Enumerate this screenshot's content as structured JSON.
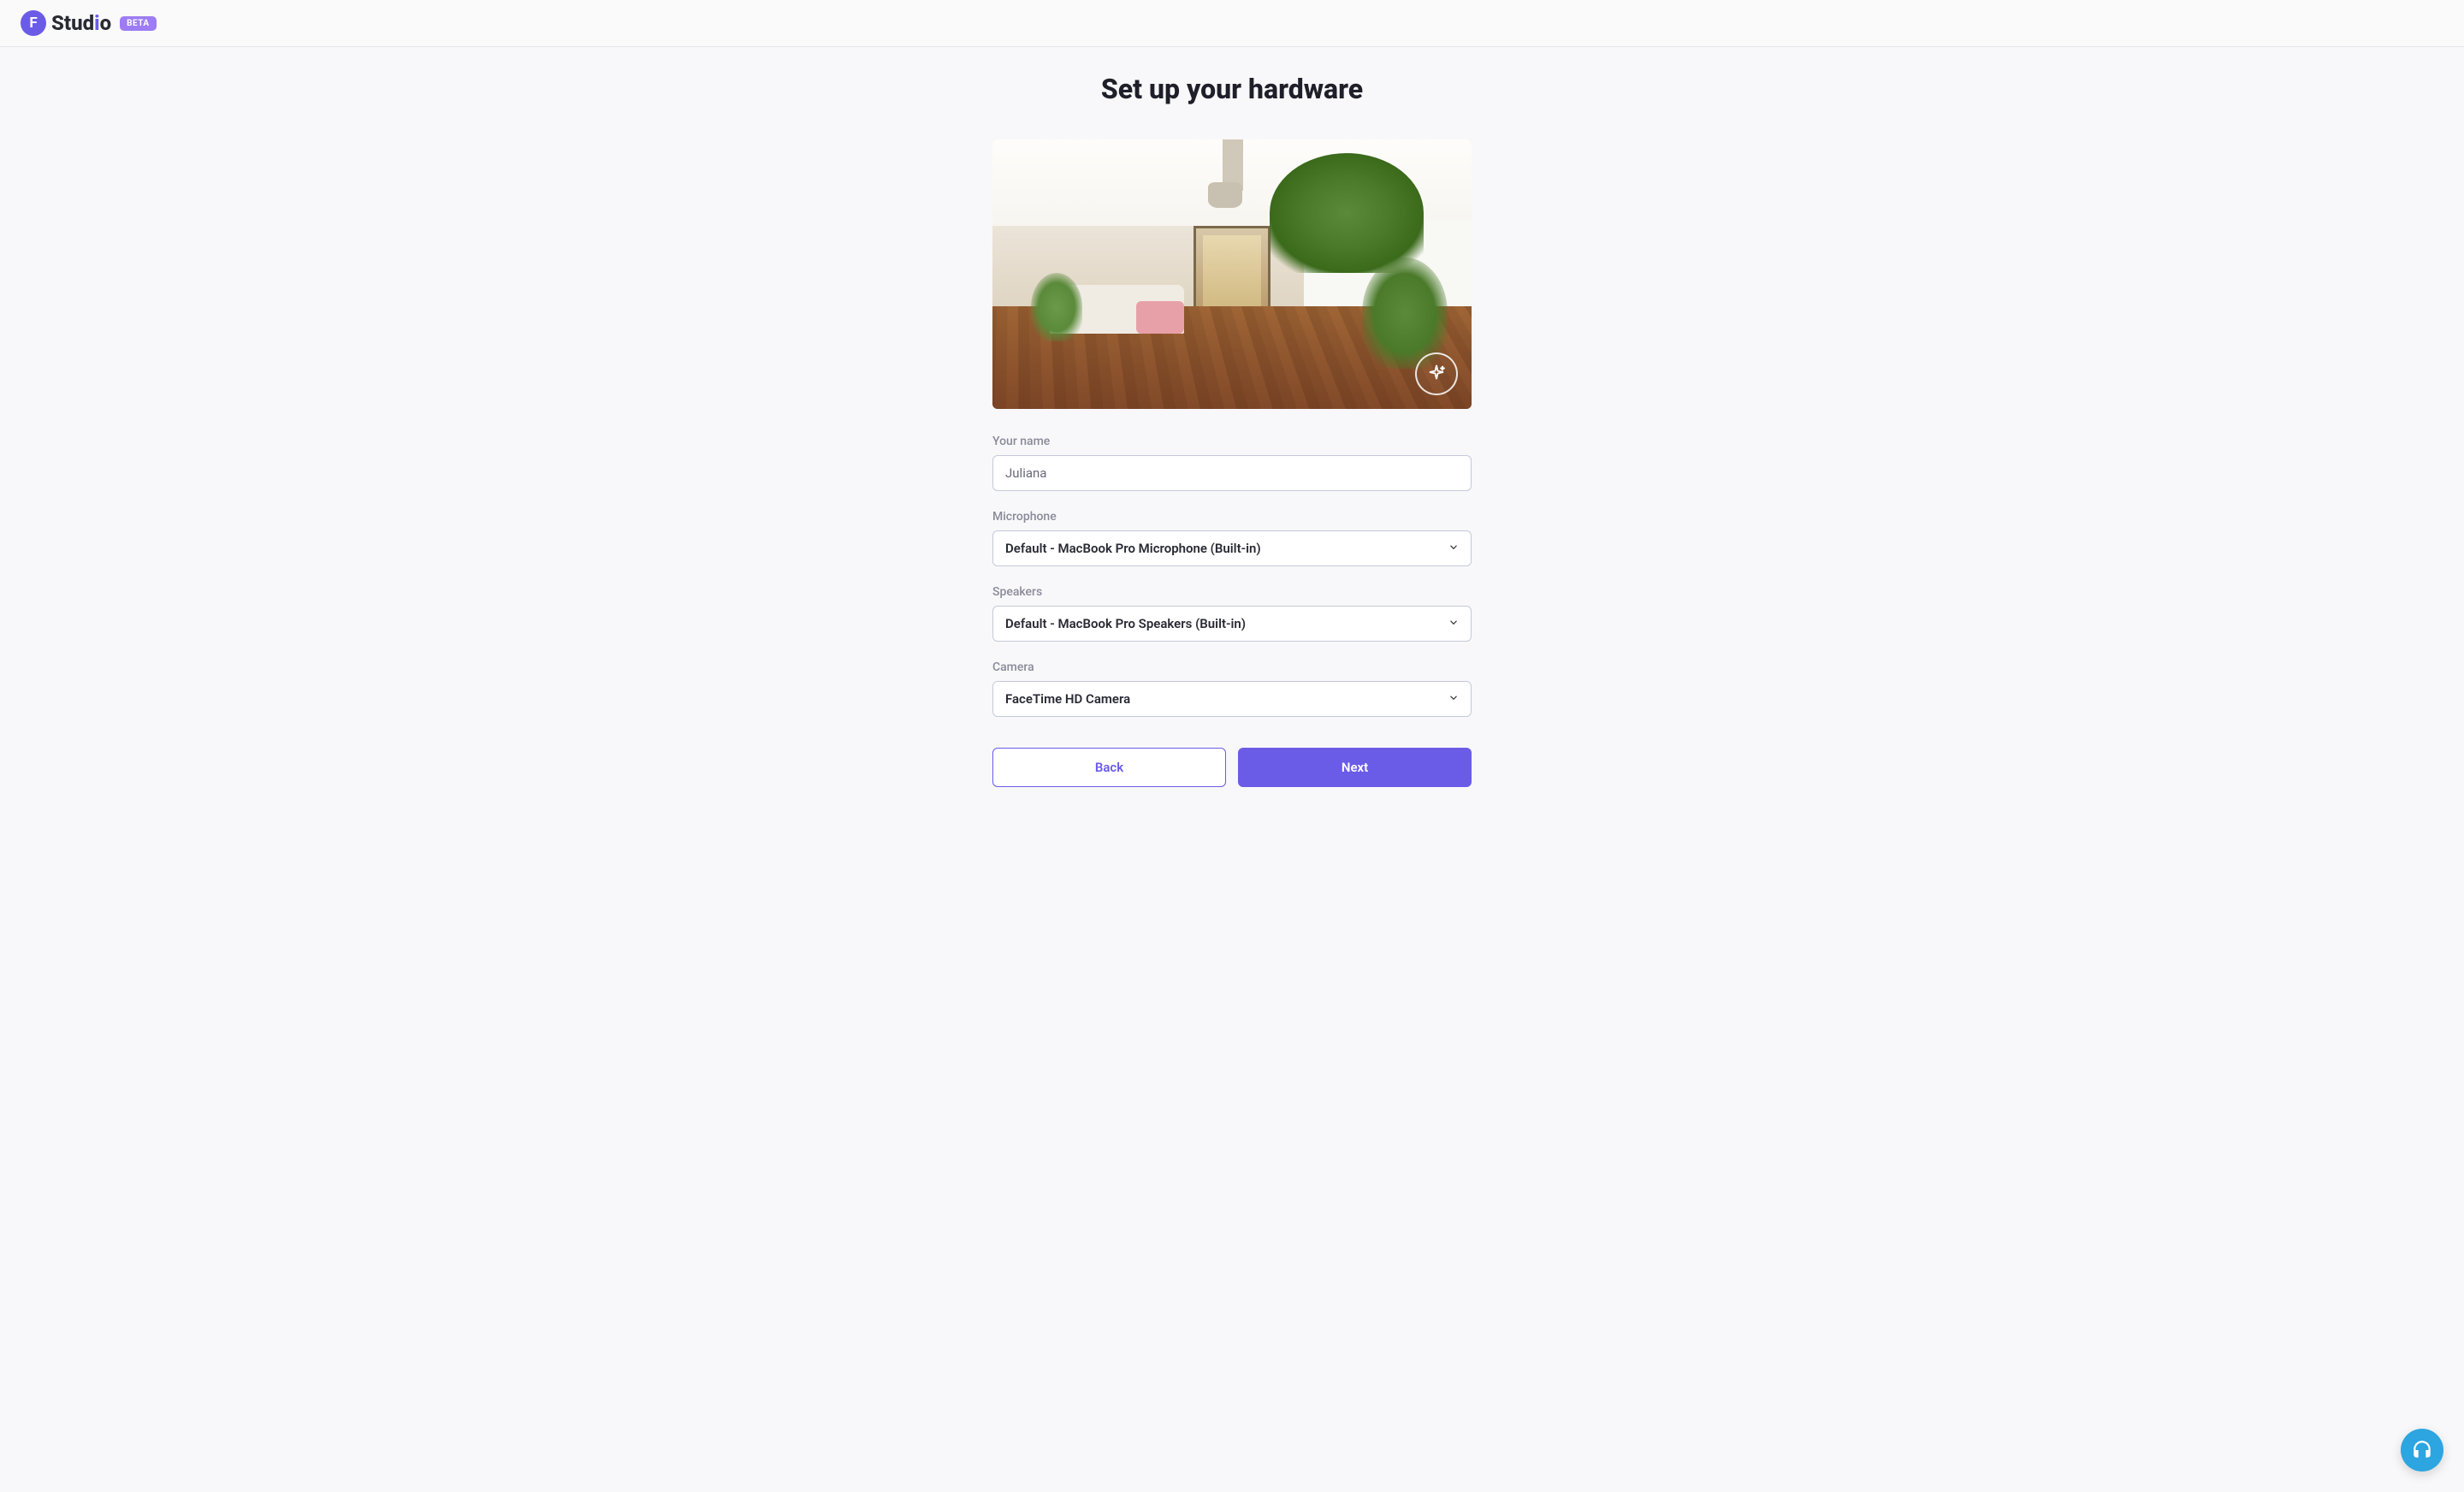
{
  "branding": {
    "logo_letter": "F",
    "logo_text_1": "Stud",
    "logo_text_2": "i",
    "logo_text_3": "o",
    "beta_label": "BETA"
  },
  "page": {
    "title": "Set up your hardware"
  },
  "form": {
    "name_label": "Your name",
    "name_value": "Juliana",
    "microphone_label": "Microphone",
    "microphone_value": "Default - MacBook Pro Microphone (Built-in)",
    "speakers_label": "Speakers",
    "speakers_value": "Default - MacBook Pro Speakers (Built-in)",
    "camera_label": "Camera",
    "camera_value": "FaceTime HD Camera"
  },
  "buttons": {
    "back": "Back",
    "next": "Next"
  }
}
